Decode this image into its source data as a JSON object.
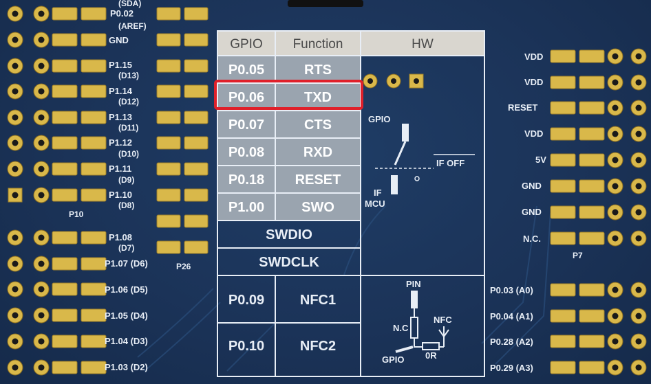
{
  "top_labels": {
    "sda": "(SDA)",
    "p002": "P0.02",
    "aref": "(AREF)"
  },
  "left_labels": [
    {
      "main": "GND",
      "sub": ""
    },
    {
      "main": "P1.15",
      "sub": "(D13)"
    },
    {
      "main": "P1.14",
      "sub": "(D12)"
    },
    {
      "main": "P1.13",
      "sub": "(D11)"
    },
    {
      "main": "P1.12",
      "sub": "(D10)"
    },
    {
      "main": "P1.11",
      "sub": "(D9)"
    },
    {
      "main": "P1.10",
      "sub": "(D8)"
    },
    {
      "main": "P1.08",
      "sub": "(D7)"
    },
    {
      "main": "P1.07 (D6)",
      "sub": ""
    },
    {
      "main": "P1.06 (D5)",
      "sub": ""
    },
    {
      "main": "P1.05 (D4)",
      "sub": ""
    },
    {
      "main": "P1.04 (D3)",
      "sub": ""
    },
    {
      "main": "P1.03 (D2)",
      "sub": ""
    }
  ],
  "connector_labels": {
    "p10": "P10",
    "p26": "P26",
    "p7": "P7"
  },
  "right_labels": [
    "VDD",
    "VDD",
    "RESET",
    "VDD",
    "5V",
    "GND",
    "GND",
    "N.C."
  ],
  "right_lower_labels": [
    "P0.03 (A0)",
    "P0.04 (A1)",
    "P0.28 (A2)",
    "P0.29 (A3)"
  ],
  "table": {
    "headers": {
      "gpio": "GPIO",
      "function": "Function",
      "hw": "HW"
    },
    "rows": [
      {
        "gpio": "P0.05",
        "function": "RTS"
      },
      {
        "gpio": "P0.06",
        "function": "TXD"
      },
      {
        "gpio": "P0.07",
        "function": "CTS"
      },
      {
        "gpio": "P0.08",
        "function": "RXD"
      },
      {
        "gpio": "P0.18",
        "function": "RESET"
      },
      {
        "gpio": "P1.00",
        "function": "SWO"
      }
    ],
    "span_rows": [
      "SWDIO",
      "SWDCLK"
    ],
    "nfc_rows": [
      {
        "gpio": "P0.09",
        "function": "NFC1"
      },
      {
        "gpio": "P0.10",
        "function": "NFC2"
      }
    ],
    "highlighted_row": "P0.06"
  },
  "hw_diagram": {
    "gpio": "GPIO",
    "if_off": "IF OFF",
    "if_mcu_1": "IF",
    "if_mcu_2": "MCU",
    "pin": "PIN",
    "nc": "N.C",
    "nfc": "NFC",
    "gpio2": "GPIO",
    "zero_r": "0R"
  },
  "colors": {
    "board": "#1b3358",
    "silkscreen": "#e8eef6",
    "pad_gold": "#d9b84a",
    "table_header": "#d9d6cf",
    "table_grey": "#9aa4af",
    "highlight": "#e0202a"
  }
}
